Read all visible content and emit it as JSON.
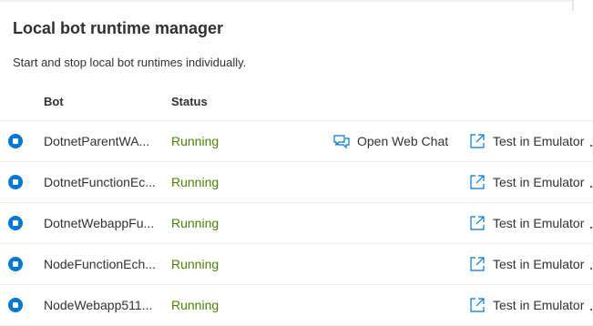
{
  "header": {
    "title": "Local bot runtime manager",
    "subtitle": "Start and stop local bot runtimes individually."
  },
  "table": {
    "columns": {
      "bot": "Bot",
      "status": "Status"
    },
    "actions": {
      "open_web_chat": "Open Web Chat",
      "test_in_emulator": "Test in Emulator"
    },
    "icons": {
      "stop": "stop-circle-icon",
      "web_chat": "chat-icon",
      "emulator": "open-in-new-window-icon"
    },
    "colors": {
      "accent": "#0078d4",
      "running": "#498205"
    },
    "rows": [
      {
        "bot": "DotnetParentWA...",
        "status": "Running",
        "web_chat": true
      },
      {
        "bot": "DotnetFunctionEc...",
        "status": "Running",
        "web_chat": false
      },
      {
        "bot": "DotnetWebappFu...",
        "status": "Running",
        "web_chat": false
      },
      {
        "bot": "NodeFunctionEch...",
        "status": "Running",
        "web_chat": false
      },
      {
        "bot": "NodeWebapp511...",
        "status": "Running",
        "web_chat": false
      }
    ]
  }
}
